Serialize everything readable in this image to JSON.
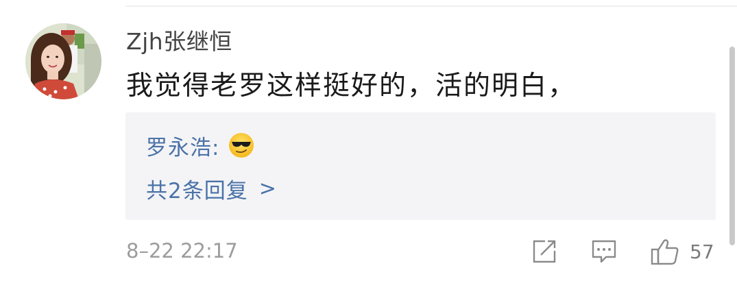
{
  "comment": {
    "username": "Zjh张继恒",
    "text": "我觉得老罗这样挺好的，活的明白，",
    "timestamp": "8–22 22:17",
    "avatar_icon": "user-photo-avatar"
  },
  "reply": {
    "author": "罗永浩:",
    "emoji_icon": "sunglasses-face-emoji",
    "count_text": "共2条回复",
    "chevron": ">"
  },
  "actions": {
    "share_icon": "share-icon",
    "comment_icon": "comment-icon",
    "like_icon": "thumbs-up-icon",
    "like_count": "57"
  },
  "colors": {
    "link_blue": "#4a72a8",
    "reply_bg": "#f4f4f6",
    "meta_gray": "#9c9c9c"
  }
}
